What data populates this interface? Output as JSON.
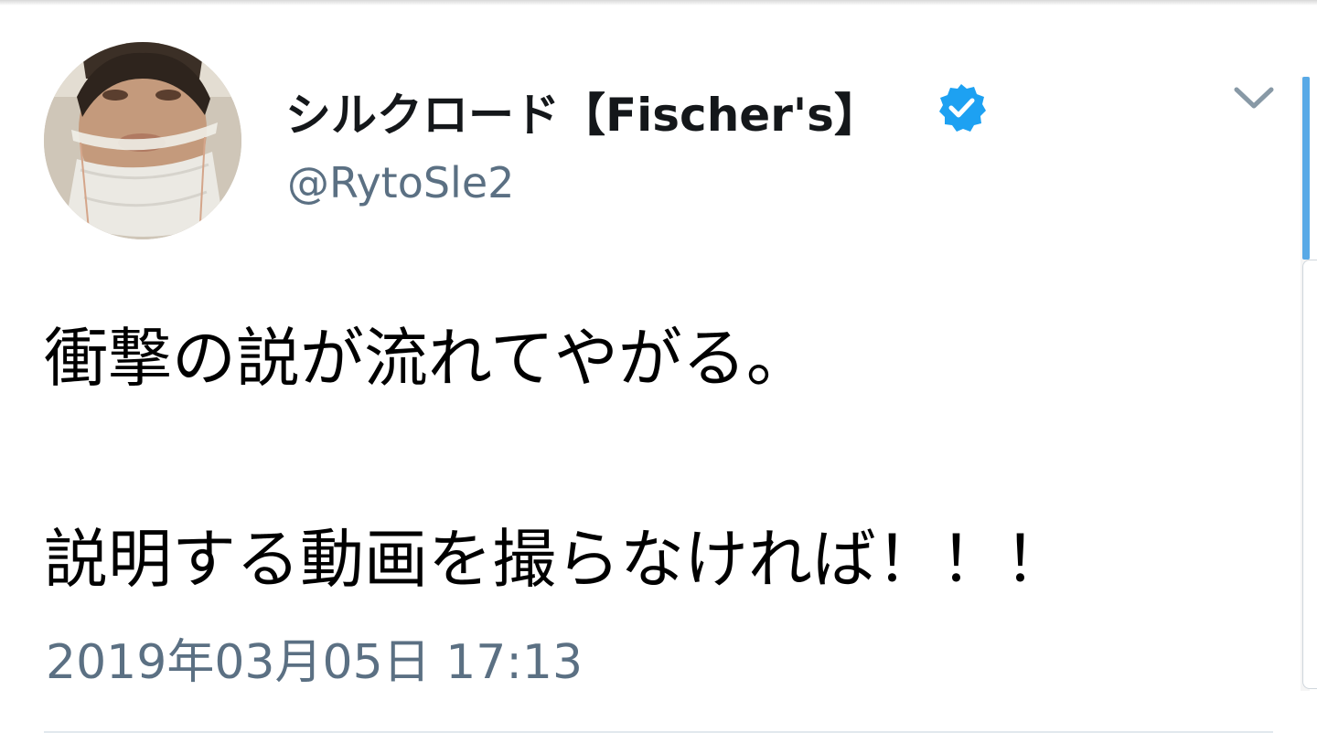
{
  "user": {
    "display_name": "シルクロード【Fischer's】",
    "handle": "@RytoSle2",
    "verified": true,
    "avatar_icon": "profile-photo"
  },
  "tweet": {
    "line1": "衝撃の説が流れてやがる。",
    "line2": "説明する動画を撮らなければ！！！",
    "timestamp": "2019年03月05日 17:13"
  },
  "icons": {
    "verified": "verified-badge-icon",
    "menu": "chevron-down-icon"
  },
  "colors": {
    "verified_blue": "#1da1f2",
    "secondary_text": "#5b7083",
    "primary_text": "#14171a"
  }
}
